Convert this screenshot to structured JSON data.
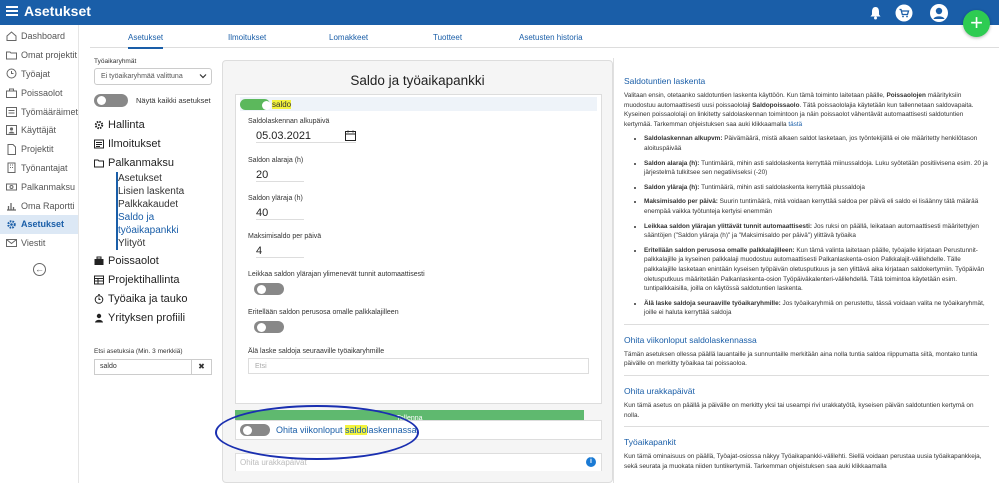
{
  "app": {
    "title": "Asetukset"
  },
  "sidebar": {
    "items": [
      {
        "label": "Dashboard",
        "icon": "home-icon"
      },
      {
        "label": "Omat projektit",
        "icon": "folder-icon"
      },
      {
        "label": "Työajat",
        "icon": "clock-icon"
      },
      {
        "label": "Poissaolot",
        "icon": "suitcase-icon"
      },
      {
        "label": "Työmääräimet",
        "icon": "list-icon"
      },
      {
        "label": "Käyttäjät",
        "icon": "user-icon"
      },
      {
        "label": "Projektit",
        "icon": "file-icon"
      },
      {
        "label": "Työnantajat",
        "icon": "building-icon"
      },
      {
        "label": "Palkanmaksu",
        "icon": "money-icon"
      },
      {
        "label": "Oma Raportti",
        "icon": "chart-icon"
      },
      {
        "label": "Asetukset",
        "icon": "gear-icon",
        "active": true
      },
      {
        "label": "Viestit",
        "icon": "mail-icon"
      }
    ]
  },
  "tabs": [
    {
      "label": "Asetukset",
      "active": true
    },
    {
      "label": "Ilmoitukset"
    },
    {
      "label": "Lomakkeet"
    },
    {
      "label": "Tuotteet"
    },
    {
      "label": "Asetusten historia"
    }
  ],
  "left": {
    "group_label": "Työaikaryhmät",
    "group_value": "Ei työaikaryhmää valittuna",
    "show_all_label": "Näytä kaikki asetukset",
    "nav": {
      "hallinta": "Hallinta",
      "ilmoitukset": "Ilmoitukset",
      "palkanmaksu": "Palkanmaksu",
      "sub": [
        "Asetukset",
        "Lisien laskenta",
        "Palkkakaudet",
        "Saldo ja työaikapankki",
        "Ylityöt"
      ],
      "poissaolot": "Poissaolot",
      "projektihallinta": "Projektihallinta",
      "tyoaika": "Työaika ja tauko",
      "yritys": "Yrityksen profiili"
    },
    "search_label": "Etsi asetuksia (Min. 3 merkkiä)",
    "search_value": "saldo",
    "clear": "✖"
  },
  "card": {
    "title": "Saldo ja työaikapankki",
    "toggle_label": "saldo",
    "start_label": "Saldolaskennan alkupäivä",
    "start_value": "05.03.2021",
    "lower_label": "Saldon alaraja (h)",
    "lower_value": "20",
    "upper_label": "Saldon yläraja (h)",
    "upper_value": "40",
    "max_label": "Maksimisaldo per päivä",
    "max_value": "4",
    "cut_label": "Leikkaa saldon ylärajan ylimenevät tunnit automaattisesti",
    "separate_label": "Eritellään saldon perusosa omalle palkkalajilleen",
    "skip_groups_label": "Älä laske saldoja seuraaville työaikaryhmille",
    "skip_groups_placeholder": "Etsi",
    "save": "Tallenna",
    "weekend_pre": "Ohita viikonloput ",
    "weekend_hl": "saldo",
    "weekend_post": "laskennassa",
    "acc_partial": "Ohita urakkapäivät"
  },
  "help": {
    "h1": "Saldotuntien laskenta",
    "p1a": "Valitaan ensin, otetaanko saldotuntien laskenta käyttöön. Kun tämä toiminto laitetaan päälle, ",
    "p1b": "Poissaolojen",
    "p1c": " määrityksiin muodostuu automaattisesti uusi poissaololaji ",
    "p1d": "Saldopoissaolo",
    "p1e": ". Tätä poissaololajia käytetään kun tallennetaan saldovapaita. Kyseinen poissaololaji on linkitetty saldolaskennan toimintoon ja näin poissaolot vähentävät automaattisesti saldotuntien kertymää. Tarkemman ohjeistuksen saa auki klikkaamalla ",
    "p1link": "tästä",
    "bullets": [
      {
        "b": "Saldolaskennan alkupvm:",
        "t": " Päivämäärä, mistä alkaen saldot lasketaan, jos työntekijällä ei ole määritetty henkilötason aloituspäivää"
      },
      {
        "b": "Saldon alaraja (h):",
        "t": " Tuntimäärä, mihin asti saldolaskenta kerryttää miinussaldoja. Luku syötetään positiivisena esim. 20 ja järjestelmä tulkitsee sen negatiiviseksi (-20)"
      },
      {
        "b": "Saldon yläraja (h):",
        "t": " Tuntimäärä, mihin asti saldolaskenta kerryttää plussaldoja"
      },
      {
        "b": "Maksimisaldo per päivä:",
        "t": " Suurin tuntimäärä, mitä voidaan kerryttää saldoa per päivä eli saldo ei lisäänny tätä määrää enempää vaikka työtunteja kertyisi enemmän"
      },
      {
        "b": "Leikkaa saldon ylärajan ylittävät tunnit automaattisesti:",
        "t": " Jos ruksi on päällä, leikataan automaattisesti määritettyjen sääntöjen (\"Saldon yläraja (h)\" ja \"Maksimisaldo per päivä\") ylittävä työaika"
      },
      {
        "b": "Eritellään saldon perusosa omalle palkkalajilleen:",
        "t": " Kun tämä valinta laitetaan päälle, työajalle kirjataan Perustunnit-palkkalajille ja kyseinen palkkalaji muodostuu automaattisesti Palkanlaskenta-osion Palkkalajit-välilehdelle. Tälle palkkalajille lasketaan enintään kyseisen työpäivän oletusputkuus ja sen ylittävä aika kirjataan saldokertymiin. Työpäivän oletusputkuus määritetään Palkanlaskenta-osion Työpäiväkalenteri-välilehdellä. Tätä toimintoa käytetään esim. tuntipalkkaisilla, joilla on käytössä saldotuntien laskenta."
      },
      {
        "b": "Älä laske saldoja seuraaville työaikaryhmille:",
        "t": " Jos työaikaryhmiä on perustettu, tässä voidaan valita ne työaikaryhmät, joille ei haluta kerryttää saldoja"
      }
    ],
    "h2": "Ohita viikonloput saldolaskennassa",
    "p2": "Tämän asetuksen ollessa päällä lauantaille ja sunnuntaille merkitään aina nolla tuntia saldoa riippumatta siitä, montako tuntia päivälle on merkitty työaikaa tai poissaoloa.",
    "h3": "Ohita urakkapäivät",
    "p3": "Kun tämä asetus on päällä ja päivälle on merkitty yksi tai useampi rivi urakkatyötä, kyseisen päivän saldotuntien kertymä on nolla.",
    "h4": "Työaikapankit",
    "p4": "Kun tämä ominaisuus on päällä, Työajat-osiossa näkyy Työaikapankki-välilehti. Siellä voidaan perustaa uusia työaikapankkeja, sekä seurata ja muokata niiden tuntikertymiä. Tarkemman ohjeistuksen saa auki klikkaamalla"
  }
}
